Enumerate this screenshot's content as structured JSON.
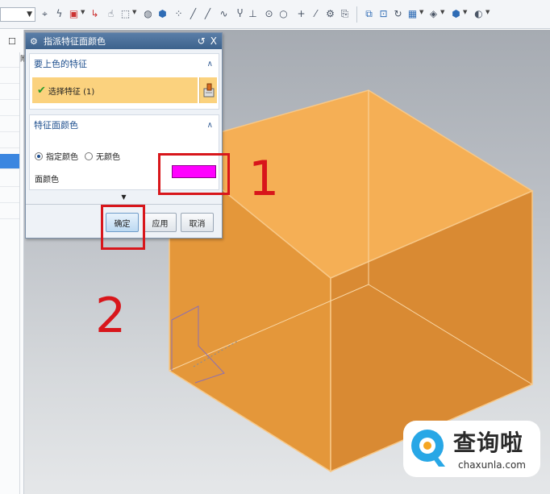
{
  "dialog": {
    "title": "指派特征面颜色",
    "title_controls": {
      "reset": "↺",
      "close": "X"
    },
    "section1": {
      "heading": "要上色的特征",
      "select_label": "选择特征 (1)"
    },
    "section2": {
      "heading": "特征面颜色",
      "option_specify": "指定颜色",
      "option_none": "无颜色",
      "face_color_label": "面颜色",
      "face_color": "#ff00ff"
    },
    "buttons": {
      "ok": "确定",
      "apply": "应用",
      "cancel": "取消"
    }
  },
  "annotations": {
    "label1": "1",
    "label2": "2"
  },
  "watermark": {
    "title": "查询啦",
    "url": "chaxunla.com"
  },
  "colors": {
    "accent_blue": "#3b6a9e",
    "cube_face": "#f4a543",
    "annotation_red": "#d8161b"
  }
}
